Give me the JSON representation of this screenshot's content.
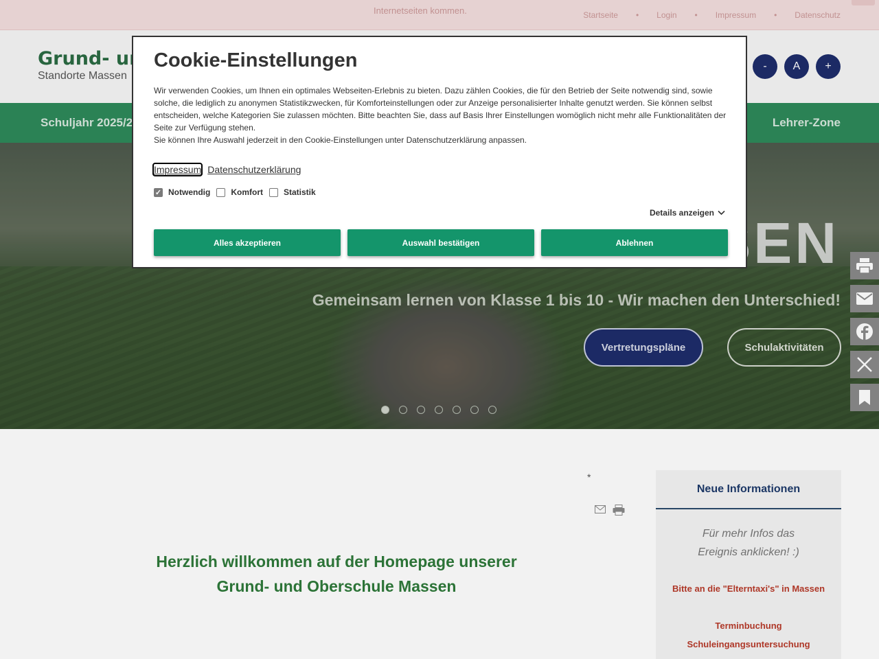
{
  "topbar": {
    "notice": "Internetseiten kommen.",
    "links": [
      "Startseite",
      "Login",
      "Impressum",
      "Datenschutz"
    ]
  },
  "header": {
    "title": "Grund- und",
    "subtitle": "Standorte Massen",
    "font_buttons": [
      "-",
      "A",
      "+"
    ]
  },
  "nav": {
    "left_item": "Schuljahr 2025/2",
    "right_item": "Lehrer-Zone"
  },
  "hero": {
    "big_text": "SEN",
    "tagline": "Gemeinsam lernen von Klasse 1 bis 10 - Wir machen den Unterschied!",
    "button_primary": "Vertretungspläne",
    "button_secondary": "Schulaktivitäten",
    "slide_count": 7,
    "active_slide": 1
  },
  "social": [
    "print-icon",
    "mail-icon",
    "facebook-icon",
    "x-icon",
    "bookmark-icon"
  ],
  "content": {
    "asterisk": "*",
    "welcome": "Herzlich willkommen auf der Homepage unserer Grund- und Oberschule Massen"
  },
  "sidebar": {
    "heading": "Neue Informationen",
    "info_line1": "Für mehr Infos das",
    "info_line2": "Ereignis anklicken! :)",
    "link1": "Bitte an die \"Elterntaxi's\" in Massen",
    "link2_line1": "Terminbuchung",
    "link2_line2": "Schuleingangsuntersuchung"
  },
  "cookie_modal": {
    "title": "Cookie-Einstellungen",
    "paragraph1": "Wir verwenden Cookies, um Ihnen ein optimales Webseiten-Erlebnis zu bieten. Dazu zählen Cookies, die für den Betrieb der Seite notwendig sind, sowie solche, die lediglich zu anonymen Statistikzwecken, für Komforteinstellungen oder zur Anzeige personalisierter Inhalte genutzt werden. Sie können selbst entscheiden, welche Kategorien Sie zulassen möchten. Bitte beachten Sie, dass auf Basis Ihrer Einstellungen womöglich nicht mehr alle Funktionalitäten der Seite zur Verfügung stehen.",
    "paragraph2": "Sie können Ihre Auswahl jederzeit in den Cookie-Einstellungen unter Datenschutzerklärung anpassen.",
    "link_impressum": "Impressum",
    "link_datenschutz": "Datenschutzerklärung",
    "check_notwendig": "Notwendig",
    "check_komfort": "Komfort",
    "check_statistik": "Statistik",
    "details": "Details anzeigen",
    "btn_accept_all": "Alles akzeptieren",
    "btn_confirm": "Auswahl bestätigen",
    "btn_reject": "Ablehnen",
    "accent_color": "#14956b"
  }
}
